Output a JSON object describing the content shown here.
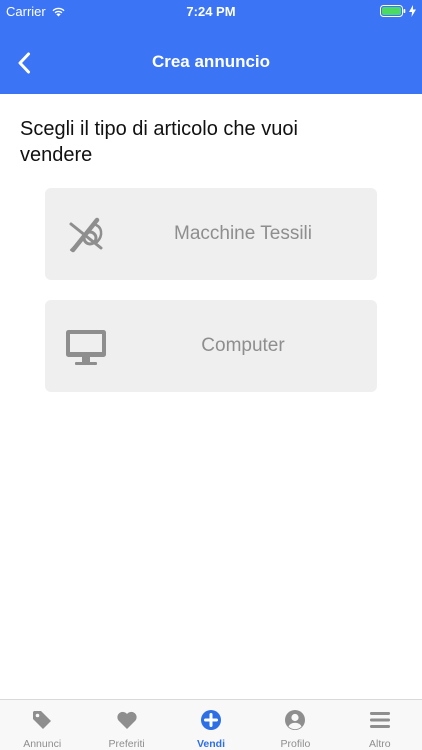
{
  "status_bar": {
    "carrier": "Carrier",
    "time": "7:24 PM"
  },
  "header": {
    "title": "Crea annuncio",
    "back_icon": "chevron-left-icon"
  },
  "main": {
    "prompt": "Scegli il tipo di articolo che vuoi vendere",
    "options": [
      {
        "label": "Macchine Tessili",
        "icon": "sewing-tools-icon"
      },
      {
        "label": "Computer",
        "icon": "monitor-icon"
      }
    ]
  },
  "tab_bar": {
    "active": "Vendi",
    "tabs": [
      {
        "label": "Annunci",
        "icon": "tag-icon"
      },
      {
        "label": "Preferiti",
        "icon": "heart-icon"
      },
      {
        "label": "Vendi",
        "icon": "plus-circle-icon"
      },
      {
        "label": "Profilo",
        "icon": "user-icon"
      },
      {
        "label": "Altro",
        "icon": "menu-icon"
      }
    ]
  },
  "colors": {
    "primary": "#3b74f4",
    "active_tab": "#2f6fe4",
    "inactive": "#8e8e8e",
    "card": "#efefef",
    "battery": "#4cd964"
  }
}
